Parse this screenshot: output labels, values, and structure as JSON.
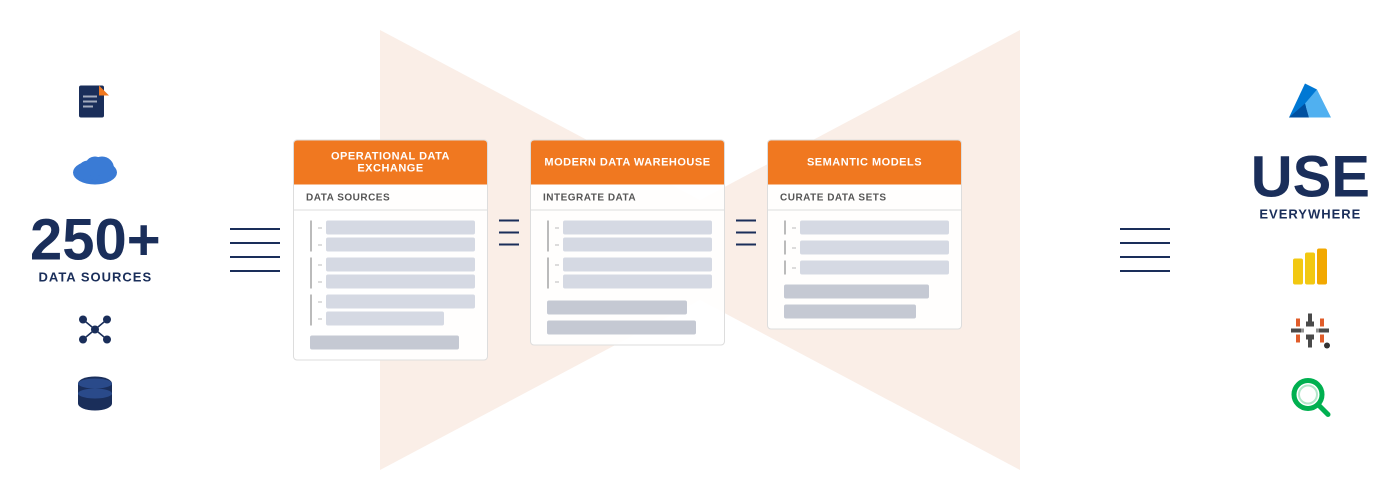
{
  "left": {
    "number": "250+",
    "label": "DATA SOURCES"
  },
  "right": {
    "main": "USE",
    "sub": "EVERYWHERE"
  },
  "panels": [
    {
      "id": "operational",
      "header": "OPERATIONAL DATA EXCHANGE",
      "subheader": "DATA SOURCES",
      "rows": [
        {
          "bars": [
            1,
            1
          ]
        },
        {
          "bars": [
            1,
            1
          ]
        },
        {
          "bars": [
            1,
            1
          ]
        },
        {
          "bars": [
            1,
            1
          ]
        },
        {
          "bars": [
            2
          ]
        }
      ]
    },
    {
      "id": "warehouse",
      "header": "MODERN DATA WAREHOUSE",
      "subheader": "INTEGRATE DATA",
      "rows": [
        {
          "bars": [
            1,
            1
          ]
        },
        {
          "bars": [
            1,
            1
          ]
        },
        {
          "bars": [
            1
          ]
        },
        {
          "bars": [
            2
          ]
        }
      ]
    },
    {
      "id": "semantic",
      "header": "SEMANTIC MODELS",
      "subheader": "CURATE DATA SETS",
      "rows": [
        {
          "bars": [
            1
          ]
        },
        {
          "bars": [
            1
          ]
        },
        {
          "bars": [
            1
          ]
        }
      ]
    }
  ],
  "icons": {
    "left": [
      "document",
      "cloud",
      "network",
      "database"
    ],
    "right": [
      "azure",
      "powerbi",
      "tableau",
      "search"
    ]
  }
}
